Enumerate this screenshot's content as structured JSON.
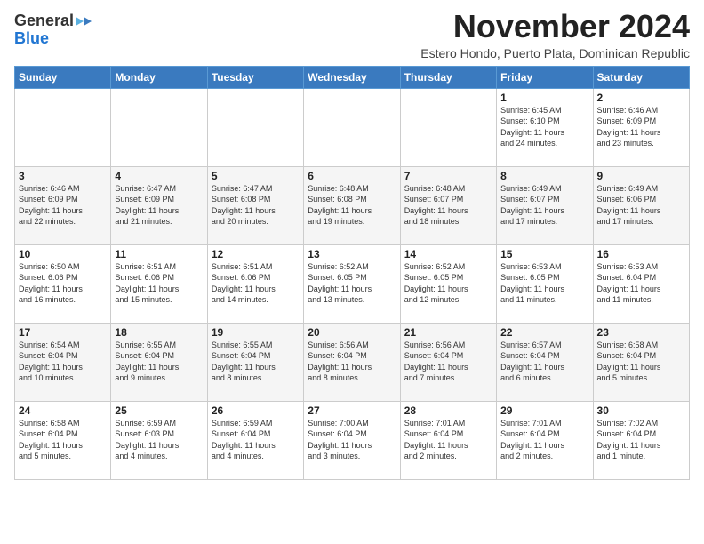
{
  "logo": {
    "general": "General",
    "blue": "Blue"
  },
  "title": "November 2024",
  "subtitle": "Estero Hondo, Puerto Plata, Dominican Republic",
  "weekdays": [
    "Sunday",
    "Monday",
    "Tuesday",
    "Wednesday",
    "Thursday",
    "Friday",
    "Saturday"
  ],
  "weeks": [
    [
      {
        "day": "",
        "info": ""
      },
      {
        "day": "",
        "info": ""
      },
      {
        "day": "",
        "info": ""
      },
      {
        "day": "",
        "info": ""
      },
      {
        "day": "",
        "info": ""
      },
      {
        "day": "1",
        "info": "Sunrise: 6:45 AM\nSunset: 6:10 PM\nDaylight: 11 hours and 24 minutes."
      },
      {
        "day": "2",
        "info": "Sunrise: 6:46 AM\nSunset: 6:09 PM\nDaylight: 11 hours and 23 minutes."
      }
    ],
    [
      {
        "day": "3",
        "info": "Sunrise: 6:46 AM\nSunset: 6:09 PM\nDaylight: 11 hours and 22 minutes."
      },
      {
        "day": "4",
        "info": "Sunrise: 6:47 AM\nSunset: 6:09 PM\nDaylight: 11 hours and 21 minutes."
      },
      {
        "day": "5",
        "info": "Sunrise: 6:47 AM\nSunset: 6:08 PM\nDaylight: 11 hours and 20 minutes."
      },
      {
        "day": "6",
        "info": "Sunrise: 6:48 AM\nSunset: 6:08 PM\nDaylight: 11 hours and 19 minutes."
      },
      {
        "day": "7",
        "info": "Sunrise: 6:48 AM\nSunset: 6:07 PM\nDaylight: 11 hours and 18 minutes."
      },
      {
        "day": "8",
        "info": "Sunrise: 6:49 AM\nSunset: 6:07 PM\nDaylight: 11 hours and 17 minutes."
      },
      {
        "day": "9",
        "info": "Sunrise: 6:49 AM\nSunset: 6:06 PM\nDaylight: 11 hours and 17 minutes."
      }
    ],
    [
      {
        "day": "10",
        "info": "Sunrise: 6:50 AM\nSunset: 6:06 PM\nDaylight: 11 hours and 16 minutes."
      },
      {
        "day": "11",
        "info": "Sunrise: 6:51 AM\nSunset: 6:06 PM\nDaylight: 11 hours and 15 minutes."
      },
      {
        "day": "12",
        "info": "Sunrise: 6:51 AM\nSunset: 6:06 PM\nDaylight: 11 hours and 14 minutes."
      },
      {
        "day": "13",
        "info": "Sunrise: 6:52 AM\nSunset: 6:05 PM\nDaylight: 11 hours and 13 minutes."
      },
      {
        "day": "14",
        "info": "Sunrise: 6:52 AM\nSunset: 6:05 PM\nDaylight: 11 hours and 12 minutes."
      },
      {
        "day": "15",
        "info": "Sunrise: 6:53 AM\nSunset: 6:05 PM\nDaylight: 11 hours and 11 minutes."
      },
      {
        "day": "16",
        "info": "Sunrise: 6:53 AM\nSunset: 6:04 PM\nDaylight: 11 hours and 11 minutes."
      }
    ],
    [
      {
        "day": "17",
        "info": "Sunrise: 6:54 AM\nSunset: 6:04 PM\nDaylight: 11 hours and 10 minutes."
      },
      {
        "day": "18",
        "info": "Sunrise: 6:55 AM\nSunset: 6:04 PM\nDaylight: 11 hours and 9 minutes."
      },
      {
        "day": "19",
        "info": "Sunrise: 6:55 AM\nSunset: 6:04 PM\nDaylight: 11 hours and 8 minutes."
      },
      {
        "day": "20",
        "info": "Sunrise: 6:56 AM\nSunset: 6:04 PM\nDaylight: 11 hours and 8 minutes."
      },
      {
        "day": "21",
        "info": "Sunrise: 6:56 AM\nSunset: 6:04 PM\nDaylight: 11 hours and 7 minutes."
      },
      {
        "day": "22",
        "info": "Sunrise: 6:57 AM\nSunset: 6:04 PM\nDaylight: 11 hours and 6 minutes."
      },
      {
        "day": "23",
        "info": "Sunrise: 6:58 AM\nSunset: 6:04 PM\nDaylight: 11 hours and 5 minutes."
      }
    ],
    [
      {
        "day": "24",
        "info": "Sunrise: 6:58 AM\nSunset: 6:04 PM\nDaylight: 11 hours and 5 minutes."
      },
      {
        "day": "25",
        "info": "Sunrise: 6:59 AM\nSunset: 6:03 PM\nDaylight: 11 hours and 4 minutes."
      },
      {
        "day": "26",
        "info": "Sunrise: 6:59 AM\nSunset: 6:04 PM\nDaylight: 11 hours and 4 minutes."
      },
      {
        "day": "27",
        "info": "Sunrise: 7:00 AM\nSunset: 6:04 PM\nDaylight: 11 hours and 3 minutes."
      },
      {
        "day": "28",
        "info": "Sunrise: 7:01 AM\nSunset: 6:04 PM\nDaylight: 11 hours and 2 minutes."
      },
      {
        "day": "29",
        "info": "Sunrise: 7:01 AM\nSunset: 6:04 PM\nDaylight: 11 hours and 2 minutes."
      },
      {
        "day": "30",
        "info": "Sunrise: 7:02 AM\nSunset: 6:04 PM\nDaylight: 11 hours and 1 minute."
      }
    ]
  ]
}
